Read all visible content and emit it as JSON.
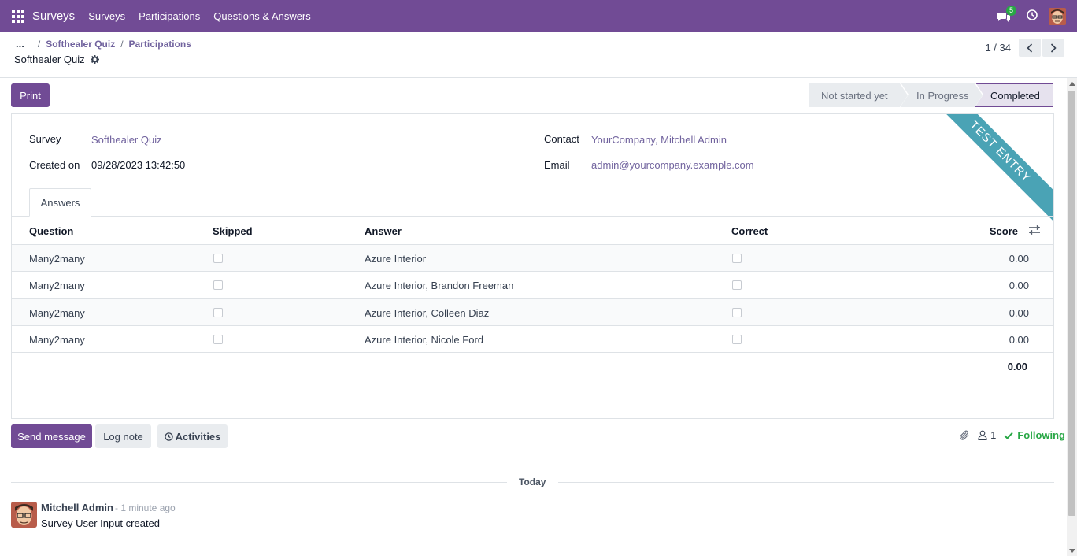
{
  "navbar": {
    "app_name": "Surveys",
    "menu": [
      "Surveys",
      "Participations",
      "Questions & Answers"
    ],
    "chat_count": "5",
    "bg_color": "#714b95"
  },
  "breadcrumb": {
    "ellipsis": "...",
    "items": [
      "Softhealer Quiz",
      "Participations"
    ],
    "record_title": "Softhealer Quiz"
  },
  "pager": {
    "text": "1 / 34"
  },
  "actions": {
    "print_label": "Print"
  },
  "statusbar": {
    "stages": [
      "Not started yet",
      "In Progress",
      "Completed"
    ],
    "current": "Completed"
  },
  "ribbon": {
    "text": "TEST ENTRY",
    "color": "#4aa3b5"
  },
  "form": {
    "survey_label": "Survey",
    "survey_value": "Softhealer Quiz",
    "created_label": "Created on",
    "created_value": "09/28/2023 13:42:50",
    "contact_label": "Contact",
    "contact_value": "YourCompany, Mitchell Admin",
    "email_label": "Email",
    "email_value": "admin@yourcompany.example.com"
  },
  "tabs": [
    {
      "label": "Answers"
    }
  ],
  "table": {
    "headers": {
      "question": "Question",
      "skipped": "Skipped",
      "answer": "Answer",
      "correct": "Correct",
      "score": "Score"
    },
    "rows": [
      {
        "question": "Many2many",
        "skipped": false,
        "answer": "Azure Interior",
        "correct": false,
        "score": "0.00"
      },
      {
        "question": "Many2many",
        "skipped": false,
        "answer": "Azure Interior, Brandon Freeman",
        "correct": false,
        "score": "0.00"
      },
      {
        "question": "Many2many",
        "skipped": false,
        "answer": "Azure Interior, Colleen Diaz",
        "correct": false,
        "score": "0.00"
      },
      {
        "question": "Many2many",
        "skipped": false,
        "answer": "Azure Interior, Nicole Ford",
        "correct": false,
        "score": "0.00"
      }
    ],
    "total": "0.00"
  },
  "chatter": {
    "send_message": "Send message",
    "log_note": "Log note",
    "activities": "Activities",
    "followers_count": "1",
    "following": "Following",
    "date_separator": "Today",
    "messages": [
      {
        "author": "Mitchell Admin",
        "time": "- 1 minute ago",
        "body": "Survey User Input created"
      }
    ]
  }
}
